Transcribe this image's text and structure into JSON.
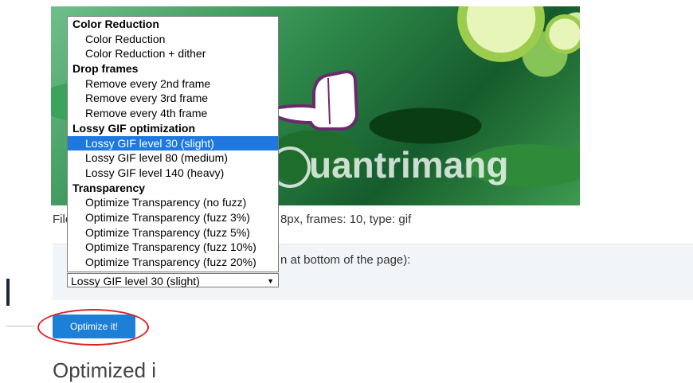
{
  "preview": {
    "watermark": "uantrimang"
  },
  "file_info": {
    "prefix": "File",
    "suffix": "8px, frames: 10, type: gif"
  },
  "method_panel": {
    "label_fragment": "n at bottom of the page):"
  },
  "method_select": {
    "value": "Lossy GIF level 30 (slight)"
  },
  "dropdown": {
    "groups": [
      {
        "label": "Color Reduction",
        "options": [
          "Color Reduction",
          "Color Reduction + dither"
        ]
      },
      {
        "label": "Drop frames",
        "options": [
          "Remove every 2nd frame",
          "Remove every 3rd frame",
          "Remove every 4th frame"
        ]
      },
      {
        "label": "Lossy GIF optimization",
        "options": [
          "Lossy GIF level 30 (slight)",
          "Lossy GIF level 80 (medium)",
          "Lossy GIF level 140 (heavy)"
        ]
      },
      {
        "label": "Transparency",
        "options": [
          "Optimize Transparency (no fuzz)",
          "Optimize Transparency (fuzz 3%)",
          "Optimize Transparency (fuzz 5%)",
          "Optimize Transparency (fuzz 10%)",
          "Optimize Transparency (fuzz 20%)"
        ]
      }
    ],
    "selected": "Lossy GIF level 30 (slight)"
  },
  "optimize_button": {
    "label": "Optimize it!"
  },
  "bottom": {
    "heading_fragment": "Optimized i"
  },
  "colors": {
    "button": "#1e7fd6",
    "highlight_ring": "#e02020",
    "selected_option": "#1e78e0"
  }
}
